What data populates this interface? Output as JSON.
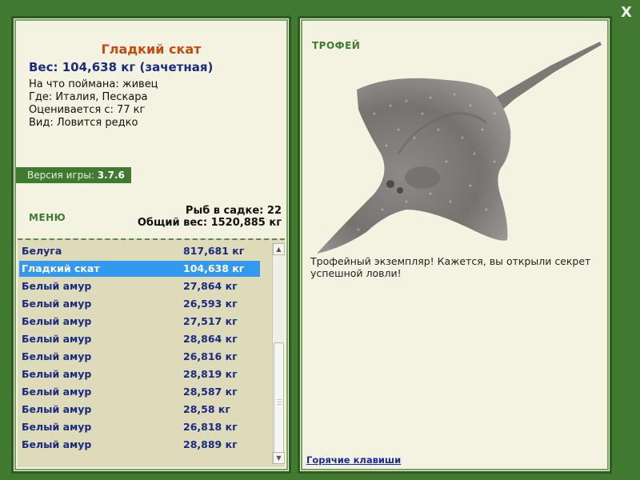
{
  "window": {
    "close_label": "X"
  },
  "fish": {
    "name": "Гладкий скат",
    "weight_line": "Вес: 104,638 кг (зачетная)",
    "bait_line": "На что поймана: живец",
    "place_line": "Где: Италия, Пескара",
    "rating_line": "Оценивается с: 77 кг",
    "kind_line": "Вид: Ловится редко"
  },
  "version": {
    "label": "Версия игры: ",
    "value": "3.7.6"
  },
  "menu_label": "МЕНЮ",
  "stats": {
    "count_line": "Рыб в садке: 22",
    "total_line": "Общий вес: 1520,885 кг"
  },
  "catch_list": [
    {
      "name": "Белуга",
      "weight": "817,681 кг"
    },
    {
      "name": "Гладкий скат",
      "weight": "104,638 кг"
    },
    {
      "name": "Белый амур",
      "weight": "27,864 кг"
    },
    {
      "name": "Белый амур",
      "weight": "26,593 кг"
    },
    {
      "name": "Белый амур",
      "weight": "27,517 кг"
    },
    {
      "name": "Белый амур",
      "weight": "28,864 кг"
    },
    {
      "name": "Белый амур",
      "weight": "26,816 кг"
    },
    {
      "name": "Белый амур",
      "weight": "28,819 кг"
    },
    {
      "name": "Белый амур",
      "weight": "28,587 кг"
    },
    {
      "name": "Белый амур",
      "weight": "28,58 кг"
    },
    {
      "name": "Белый амур",
      "weight": "26,818 кг"
    },
    {
      "name": "Белый амур",
      "weight": "28,889 кг"
    }
  ],
  "selected_index": 1,
  "trophy": {
    "label": "ТРОФЕЙ",
    "text": "Трофейный экземпляр! Кажется, вы открыли секрет успешной ловли!"
  },
  "hotkeys_label": "Горячие клавиши",
  "colors": {
    "frame_green": "#3f7a30",
    "panel_bg": "#f4f3e1",
    "list_bg": "#dedbbb",
    "title_orange": "#c84a10",
    "text_navy": "#1a2a80",
    "selection_blue": "#3399ee"
  },
  "icons": [
    "close-icon",
    "scroll-up-icon",
    "scroll-down-icon",
    "stingray-image"
  ]
}
